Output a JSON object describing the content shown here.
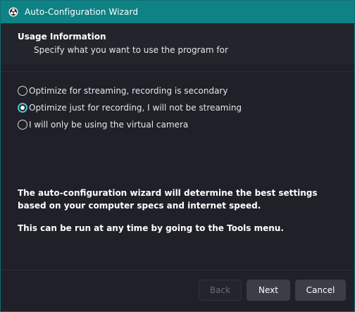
{
  "window": {
    "title": "Auto-Configuration Wizard",
    "icon": "obs-logo-icon"
  },
  "header": {
    "title": "Usage Information",
    "subtitle": "Specify what you want to use the program for"
  },
  "options": [
    {
      "label": "Optimize for streaming, recording is secondary",
      "checked": false
    },
    {
      "label": "Optimize just for recording, I will not be streaming",
      "checked": true
    },
    {
      "label": "I will only be using the virtual camera",
      "checked": false
    }
  ],
  "info": {
    "line1": "The auto-configuration wizard will determine the best settings based on your computer specs and internet speed.",
    "line2": "This can be run at any time by going to the Tools menu."
  },
  "footer": {
    "back_label": "Back",
    "next_label": "Next",
    "cancel_label": "Cancel",
    "back_enabled": false
  },
  "colors": {
    "titlebar": "#0e8284",
    "background": "#1f2028",
    "accent": "#47c6d1"
  }
}
